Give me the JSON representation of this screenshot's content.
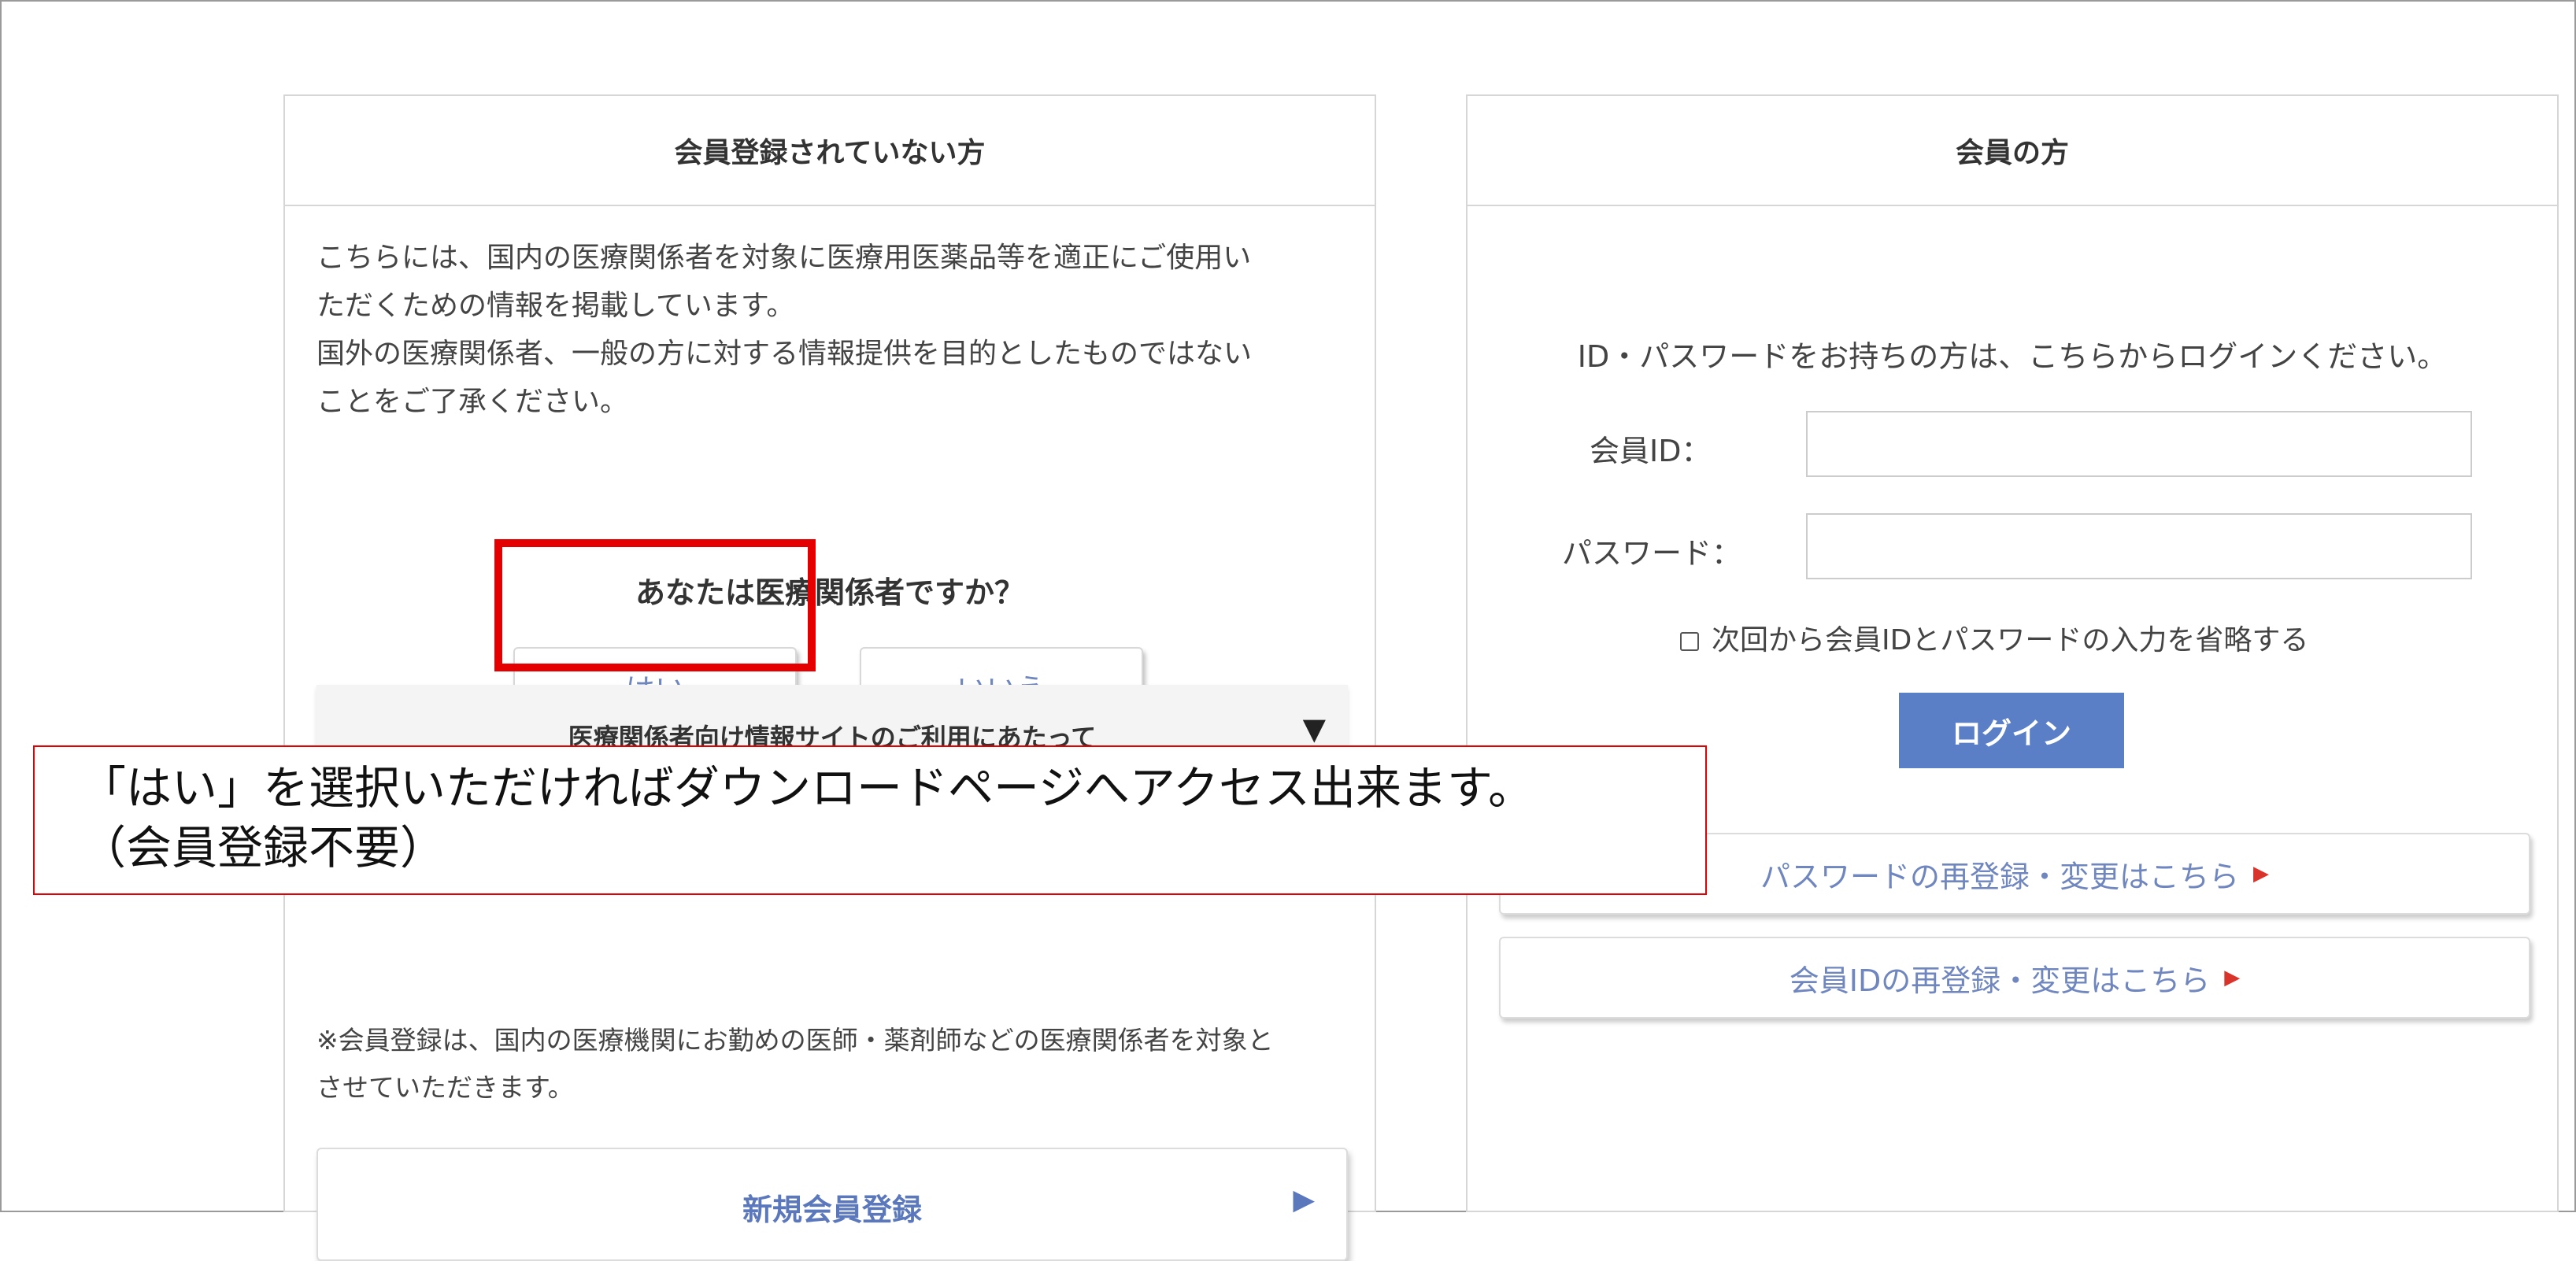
{
  "left_panel": {
    "header": "会員登録されていない方",
    "intro_lines": [
      "こちらには、国内の医療関係者を対象に医療用医薬品等を適正にご使用い",
      "ただくための情報を掲載しています。",
      "国外の医療関係者、一般の方に対する情報提供を目的としたものではない",
      "ことをご了承ください。"
    ],
    "question": "あなたは医療関係者ですか？",
    "yes_label": "はい",
    "no_label": "いいえ",
    "accordion_label": "医療関係者向け情報サイトのご利用にあたって",
    "accordion_icon": "▼",
    "note_lines": [
      "※会員登録は、国内の医療機関にお勤めの医師・薬剤師などの医療関係者を対象と",
      "させていただきます。"
    ],
    "register_label": "新規会員登録",
    "register_icon": "▶"
  },
  "callout": {
    "line1": "「はい」を選択いただければダウンロードページへアクセス出来ます。",
    "line2": "（会員登録不要）",
    "border_color": "#e40000"
  },
  "right_panel": {
    "header": "会員の方",
    "intro": "ID・パスワードをお持ちの方は、こちらからログインください。",
    "id_label": "会員ID：",
    "password_label": "パスワード：",
    "remember_label": "次回から会員IDとパスワードの入力を省略する",
    "login_label": "ログイン",
    "password_reset_link": "パスワードの再登録・変更はこちら",
    "id_reset_link": "会員IDの再登録・変更はこちら",
    "link_icon": "▶"
  },
  "colors": {
    "accent_blue": "#5a7fc6",
    "link_text": "#6f86bf",
    "highlight_red": "#e40000",
    "link_arrow_red": "#d9342b"
  }
}
